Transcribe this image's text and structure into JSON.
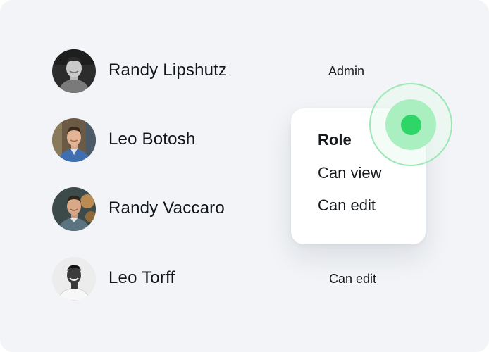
{
  "members": [
    {
      "name": "Randy Lipshutz",
      "role": "Admin",
      "avatar_icon": "person-avatar-icon"
    },
    {
      "name": "Leo Botosh",
      "role": "",
      "avatar_icon": "person-avatar-icon"
    },
    {
      "name": "Randy Vaccaro",
      "role": "",
      "avatar_icon": "person-avatar-icon"
    },
    {
      "name": "Leo Torff",
      "role": "Can edit",
      "avatar_icon": "person-avatar-icon"
    }
  ],
  "role_menu": {
    "header": "Role",
    "options": [
      "Can view",
      "Can edit"
    ]
  },
  "colors": {
    "background": "#f2f4f7",
    "menu_background": "#ffffff",
    "text": "#111418",
    "accent_green": "#2ed668",
    "accent_green_light": "#a9efc0"
  }
}
